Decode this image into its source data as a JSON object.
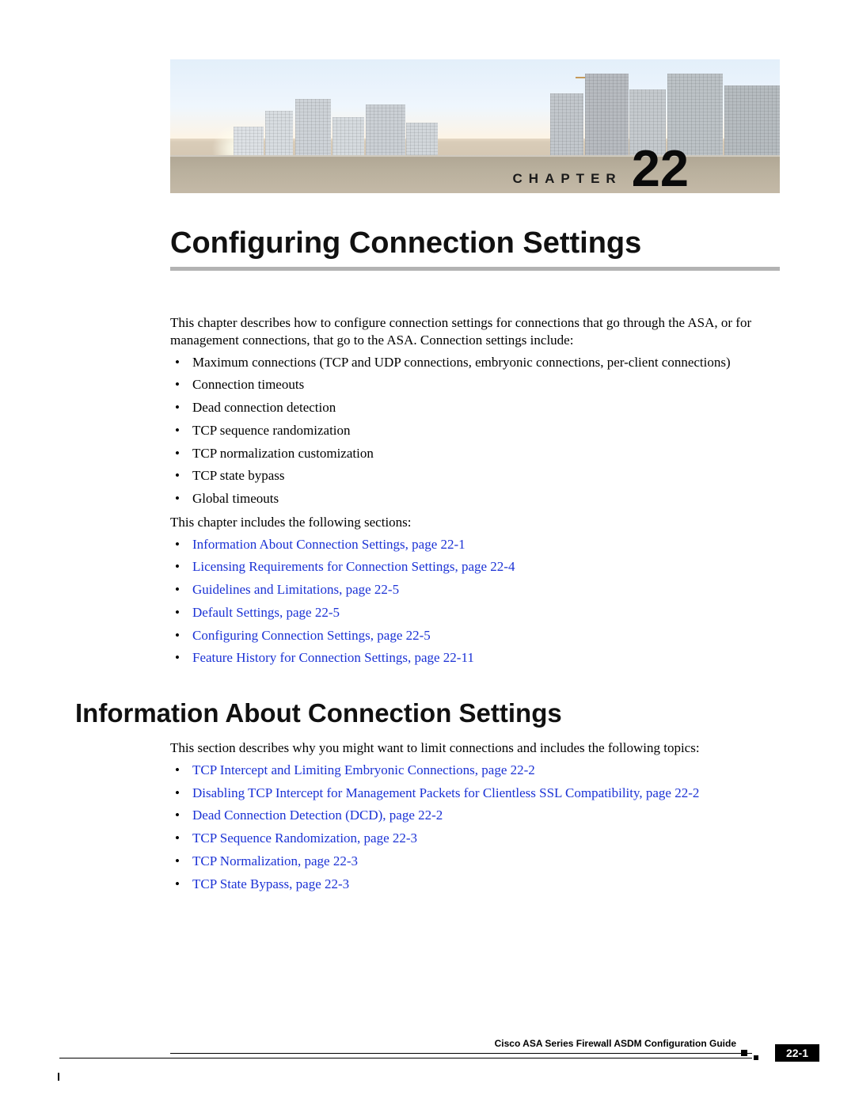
{
  "chapter": {
    "label": "CHAPTER",
    "number": "22"
  },
  "title": "Configuring Connection Settings",
  "intro1": "This chapter describes how to configure connection settings for connections that go through the ASA, or for management connections, that go to the ASA. Connection settings include:",
  "features": [
    "Maximum connections (TCP and UDP connections, embryonic connections, per-client connections)",
    "Connection timeouts",
    "Dead connection detection",
    "TCP sequence randomization",
    "TCP normalization customization",
    "TCP state bypass",
    "Global timeouts"
  ],
  "intro2": "This chapter includes the following sections:",
  "sections": [
    "Information About Connection Settings, page 22-1",
    "Licensing Requirements for Connection Settings, page 22-4",
    "Guidelines and Limitations, page 22-5",
    "Default Settings, page 22-5",
    "Configuring Connection Settings, page 22-5",
    "Feature History for Connection Settings, page 22-11"
  ],
  "section2_title": "Information About Connection Settings",
  "section2_intro": "This section describes why you might want to limit connections and includes the following topics:",
  "section2_links": [
    "TCP Intercept and Limiting Embryonic Connections, page 22-2",
    "Disabling TCP Intercept for Management Packets for Clientless SSL Compatibility, page 22-2",
    "Dead Connection Detection (DCD), page 22-2",
    "TCP Sequence Randomization, page 22-3",
    "TCP Normalization, page 22-3",
    "TCP State Bypass, page 22-3"
  ],
  "footer": {
    "guide": "Cisco ASA Series Firewall ASDM Configuration Guide",
    "page": "22-1"
  }
}
